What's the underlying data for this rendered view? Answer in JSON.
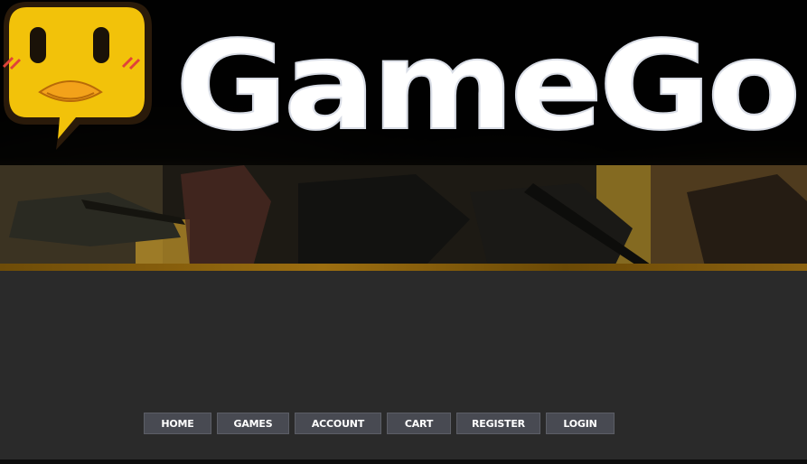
{
  "header": {
    "logo_text": "GameGo"
  },
  "nav": {
    "items": [
      {
        "label": "HOME",
        "name": "nav-home"
      },
      {
        "label": "GAMES",
        "name": "nav-games"
      },
      {
        "label": "ACCOUNT",
        "name": "nav-account"
      },
      {
        "label": "CART",
        "name": "nav-cart"
      },
      {
        "label": "REGISTER",
        "name": "nav-register"
      },
      {
        "label": "LOGIN",
        "name": "nav-login"
      }
    ]
  },
  "colors": {
    "background": "#2a2a2a",
    "nav_button": "#484a52",
    "mascot_yellow": "#f2c20a",
    "mascot_beak": "#f3a21a",
    "logo_white": "#ffffff",
    "accent_gold": "#9c6e10"
  }
}
